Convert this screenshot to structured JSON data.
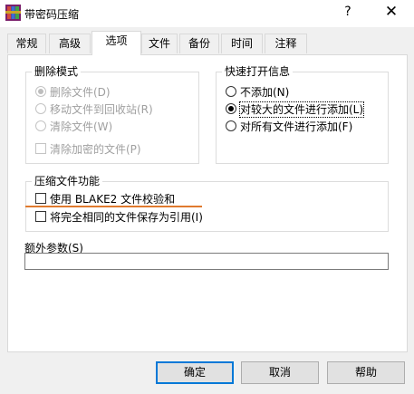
{
  "window": {
    "title": "带密码压缩",
    "help_glyph": "?",
    "close_glyph": "✕"
  },
  "tabs": [
    {
      "label": "常规"
    },
    {
      "label": "高级"
    },
    {
      "label": "选项",
      "active": true
    },
    {
      "label": "文件"
    },
    {
      "label": "备份"
    },
    {
      "label": "时间"
    },
    {
      "label": "注释"
    }
  ],
  "delete_mode": {
    "title": "删除模式",
    "options": [
      {
        "label": "删除文件(D)",
        "selected": true,
        "enabled": false
      },
      {
        "label": "移动文件到回收站(R)",
        "selected": false,
        "enabled": false
      },
      {
        "label": "清除文件(W)",
        "selected": false,
        "enabled": false
      }
    ],
    "checkbox": {
      "label": "清除加密的文件(P)",
      "checked": false,
      "enabled": false
    }
  },
  "quick_open": {
    "title": "快速打开信息",
    "options": [
      {
        "label": "不添加(N)",
        "selected": false
      },
      {
        "label": "对较大的文件进行添加(L)",
        "selected": true
      },
      {
        "label": "对所有文件进行添加(F)",
        "selected": false
      }
    ]
  },
  "compress_features": {
    "title": "压缩文件功能",
    "options": [
      {
        "label": "使用 BLAKE2 文件校验和",
        "checked": false
      },
      {
        "label": "将完全相同的文件保存为引用(I)",
        "checked": false
      }
    ]
  },
  "extra_params": {
    "label": "额外参数(S)",
    "value": ""
  },
  "buttons": {
    "ok": "确定",
    "cancel": "取消",
    "help": "帮助"
  },
  "colors": {
    "accent": "#0078d7",
    "highlight": "#e07a2e"
  }
}
